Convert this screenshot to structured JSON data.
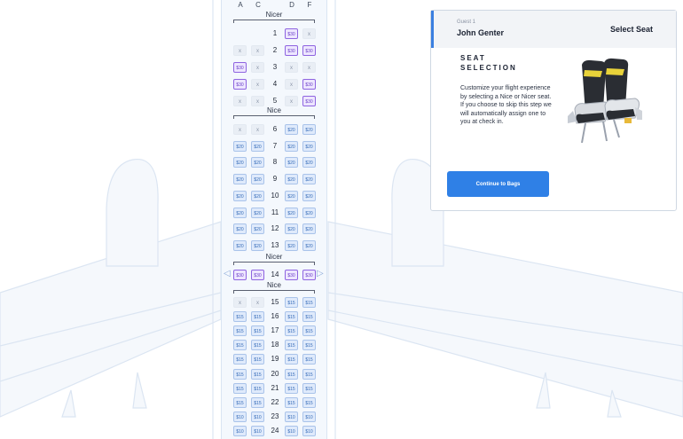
{
  "seatmap": {
    "columns": [
      "A",
      "C",
      "D",
      "F"
    ],
    "sections": [
      {
        "label": "Nicer",
        "rows": [
          {
            "num": "1",
            "seats": [
              {
                "t": "empty",
                "p": ""
              },
              {
                "t": "empty",
                "p": ""
              },
              {
                "t": "nicer",
                "p": "$30"
              },
              {
                "t": "x",
                "p": "x"
              }
            ]
          },
          {
            "num": "2",
            "seats": [
              {
                "t": "x",
                "p": "x"
              },
              {
                "t": "x",
                "p": "x"
              },
              {
                "t": "nicer",
                "p": "$30"
              },
              {
                "t": "nicer",
                "p": "$30"
              }
            ]
          },
          {
            "num": "3",
            "seats": [
              {
                "t": "nicer",
                "p": "$30"
              },
              {
                "t": "x",
                "p": "x"
              },
              {
                "t": "x",
                "p": "x"
              },
              {
                "t": "x",
                "p": "x"
              }
            ]
          },
          {
            "num": "4",
            "seats": [
              {
                "t": "nicer",
                "p": "$30"
              },
              {
                "t": "x",
                "p": "x"
              },
              {
                "t": "x",
                "p": "x"
              },
              {
                "t": "nicer",
                "p": "$30"
              }
            ]
          },
          {
            "num": "5",
            "seats": [
              {
                "t": "x",
                "p": "x"
              },
              {
                "t": "x",
                "p": "x"
              },
              {
                "t": "x",
                "p": "x"
              },
              {
                "t": "nicer",
                "p": "$30"
              }
            ]
          }
        ]
      },
      {
        "label": "Nice",
        "rows": [
          {
            "num": "6",
            "seats": [
              {
                "t": "x",
                "p": "x"
              },
              {
                "t": "x",
                "p": "x"
              },
              {
                "t": "nice",
                "p": "$20"
              },
              {
                "t": "nice",
                "p": "$20"
              }
            ]
          },
          {
            "num": "7",
            "seats": [
              {
                "t": "nice",
                "p": "$20"
              },
              {
                "t": "nice",
                "p": "$20"
              },
              {
                "t": "nice",
                "p": "$20"
              },
              {
                "t": "nice",
                "p": "$20"
              }
            ]
          },
          {
            "num": "8",
            "seats": [
              {
                "t": "nice",
                "p": "$20"
              },
              {
                "t": "nice",
                "p": "$20"
              },
              {
                "t": "nice",
                "p": "$20"
              },
              {
                "t": "nice",
                "p": "$20"
              }
            ]
          },
          {
            "num": "9",
            "seats": [
              {
                "t": "nice",
                "p": "$20"
              },
              {
                "t": "nice",
                "p": "$20"
              },
              {
                "t": "nice",
                "p": "$20"
              },
              {
                "t": "nice",
                "p": "$20"
              }
            ]
          },
          {
            "num": "10",
            "seats": [
              {
                "t": "nice",
                "p": "$20"
              },
              {
                "t": "nice",
                "p": "$20"
              },
              {
                "t": "nice",
                "p": "$20"
              },
              {
                "t": "nice",
                "p": "$20"
              }
            ]
          },
          {
            "num": "11",
            "seats": [
              {
                "t": "nice",
                "p": "$20"
              },
              {
                "t": "nice",
                "p": "$20"
              },
              {
                "t": "nice",
                "p": "$20"
              },
              {
                "t": "nice",
                "p": "$20"
              }
            ]
          },
          {
            "num": "12",
            "seats": [
              {
                "t": "nice",
                "p": "$20"
              },
              {
                "t": "nice",
                "p": "$20"
              },
              {
                "t": "nice",
                "p": "$20"
              },
              {
                "t": "nice",
                "p": "$20"
              }
            ]
          },
          {
            "num": "13",
            "seats": [
              {
                "t": "nice",
                "p": "$20"
              },
              {
                "t": "nice",
                "p": "$20"
              },
              {
                "t": "nice",
                "p": "$20"
              },
              {
                "t": "nice",
                "p": "$20"
              }
            ]
          }
        ]
      },
      {
        "label": "Nicer",
        "rows": [
          {
            "num": "14",
            "seats": [
              {
                "t": "nicer",
                "p": "$30"
              },
              {
                "t": "nicer",
                "p": "$30"
              },
              {
                "t": "nicer",
                "p": "$30"
              },
              {
                "t": "nicer",
                "p": "$30"
              }
            ]
          }
        ]
      },
      {
        "label": "Nice",
        "rows": [
          {
            "num": "15",
            "seats": [
              {
                "t": "x",
                "p": "x"
              },
              {
                "t": "x",
                "p": "x"
              },
              {
                "t": "nice",
                "p": "$15"
              },
              {
                "t": "nice",
                "p": "$15"
              }
            ]
          },
          {
            "num": "16",
            "seats": [
              {
                "t": "nice",
                "p": "$15"
              },
              {
                "t": "nice",
                "p": "$15"
              },
              {
                "t": "nice",
                "p": "$15"
              },
              {
                "t": "nice",
                "p": "$15"
              }
            ]
          },
          {
            "num": "17",
            "seats": [
              {
                "t": "nice",
                "p": "$15"
              },
              {
                "t": "nice",
                "p": "$15"
              },
              {
                "t": "nice",
                "p": "$15"
              },
              {
                "t": "nice",
                "p": "$15"
              }
            ]
          },
          {
            "num": "18",
            "seats": [
              {
                "t": "nice",
                "p": "$15"
              },
              {
                "t": "nice",
                "p": "$15"
              },
              {
                "t": "nice",
                "p": "$15"
              },
              {
                "t": "nice",
                "p": "$15"
              }
            ]
          },
          {
            "num": "19",
            "seats": [
              {
                "t": "nice",
                "p": "$15"
              },
              {
                "t": "nice",
                "p": "$15"
              },
              {
                "t": "nice",
                "p": "$15"
              },
              {
                "t": "nice",
                "p": "$15"
              }
            ]
          },
          {
            "num": "20",
            "seats": [
              {
                "t": "nice",
                "p": "$15"
              },
              {
                "t": "nice",
                "p": "$15"
              },
              {
                "t": "nice",
                "p": "$15"
              },
              {
                "t": "nice",
                "p": "$15"
              }
            ]
          },
          {
            "num": "21",
            "seats": [
              {
                "t": "nice",
                "p": "$15"
              },
              {
                "t": "nice",
                "p": "$15"
              },
              {
                "t": "nice",
                "p": "$15"
              },
              {
                "t": "nice",
                "p": "$15"
              }
            ]
          },
          {
            "num": "22",
            "seats": [
              {
                "t": "nice",
                "p": "$15"
              },
              {
                "t": "nice",
                "p": "$15"
              },
              {
                "t": "nice",
                "p": "$15"
              },
              {
                "t": "nice",
                "p": "$15"
              }
            ]
          },
          {
            "num": "23",
            "seats": [
              {
                "t": "nice",
                "p": "$10"
              },
              {
                "t": "nice",
                "p": "$10"
              },
              {
                "t": "nice",
                "p": "$10"
              },
              {
                "t": "nice",
                "p": "$10"
              }
            ]
          },
          {
            "num": "24",
            "seats": [
              {
                "t": "nice",
                "p": "$10"
              },
              {
                "t": "nice",
                "p": "$10"
              },
              {
                "t": "nice",
                "p": "$10"
              },
              {
                "t": "nice",
                "p": "$10"
              }
            ]
          }
        ]
      }
    ],
    "exit_row_arrows": {
      "left": "◁",
      "right": "▷"
    }
  },
  "panel": {
    "guest_label": "Guest 1",
    "guest_name": "John Genter",
    "title": "Select Seat",
    "section_title": "SEAT SELECTION",
    "body": "Customize your flight experience by selecting a Nice or Nicer seat. If you choose to skip this step we will automatically assign one to you at check in.",
    "cta_label": "Continue to Bags",
    "accent_color": "#2f80e6"
  },
  "colors": {
    "nicer_seat": "#8e64e0",
    "nice_seat": "#a9c3ea",
    "unavailable_seat": "#e9eef5",
    "plane_outline": "#d9e5f3"
  }
}
